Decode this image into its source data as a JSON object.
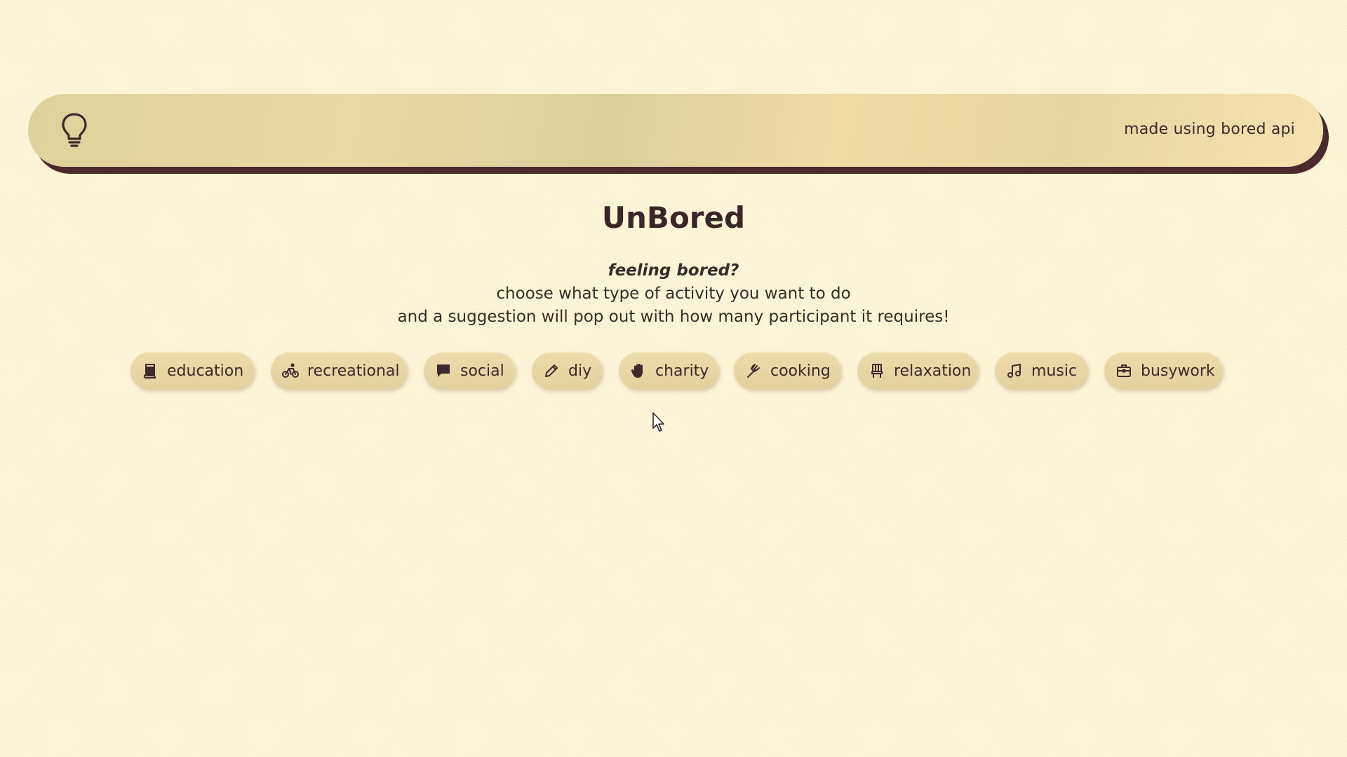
{
  "navbar": {
    "logo_icon": "lightbulb-icon",
    "credit": "made using bored api"
  },
  "main": {
    "title": "UnBored",
    "intro_lead": "feeling bored?",
    "intro_line1": "choose what type of activity you want to do",
    "intro_line2": "and a suggestion will pop out with how many participant it requires!"
  },
  "categories": [
    {
      "label": "education",
      "icon": "book-icon"
    },
    {
      "label": "recreational",
      "icon": "bicycle-icon"
    },
    {
      "label": "social",
      "icon": "chat-icon"
    },
    {
      "label": "diy",
      "icon": "pencil-icon"
    },
    {
      "label": "charity",
      "icon": "hand-icon"
    },
    {
      "label": "cooking",
      "icon": "utensils-icon"
    },
    {
      "label": "relaxation",
      "icon": "chair-icon"
    },
    {
      "label": "music",
      "icon": "music-note-icon"
    },
    {
      "label": "busywork",
      "icon": "briefcase-icon"
    }
  ],
  "colors": {
    "background": "#fdf6d7",
    "text": "#3a2a2a",
    "navbar_shadow": "#4a2a2a",
    "button": "#e6d6a2"
  }
}
